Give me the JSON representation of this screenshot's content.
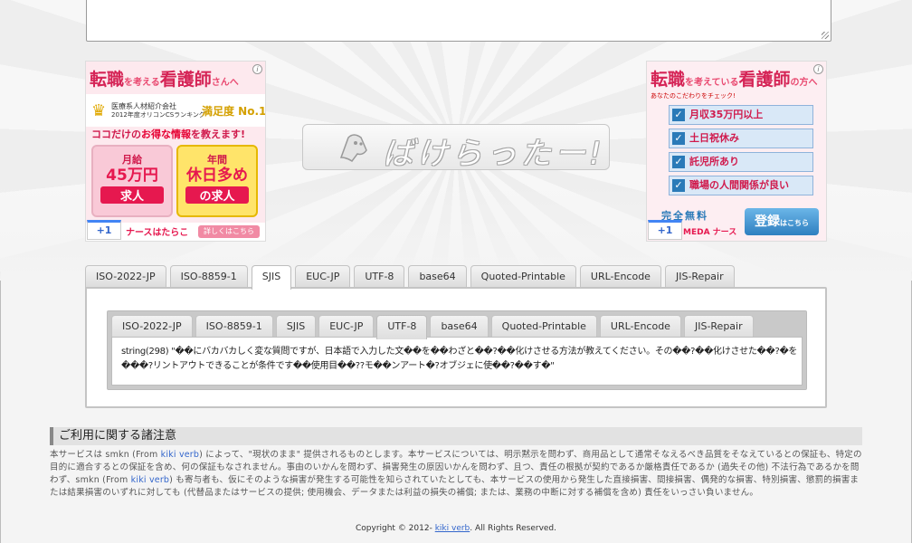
{
  "ads": {
    "left": {
      "title_a": "転職",
      "title_b": "を考える",
      "title_c": "看護師",
      "title_d": "さんへ",
      "sub1": "医療系人材紹介会社",
      "sub2": "2012年度オリコンCSランキング",
      "no1": "満足度 No.1",
      "line_a": "ココだけの",
      "line_b": "お得な情報",
      "line_c": "を教えます!",
      "card1_top": "月給",
      "card1_mid": "45万円",
      "card1_bot": "求人",
      "card2_top": "年間",
      "card2_mid": "休日多め",
      "card2_bot": "の求人",
      "brand": "ナースはたらこ",
      "cta": "詳しくはこちら",
      "plus1": "+1",
      "info": "i"
    },
    "right": {
      "title_a": "転職",
      "title_b": "を考えている",
      "title_c": "看護師",
      "title_d": "の方へ",
      "note": "あなたのこだわりをチェック!",
      "checks": [
        "月収35万円以上",
        "土日祝休み",
        "託児所あり",
        "職場の人間関係が良い"
      ],
      "free": "完全無料",
      "register": "登録",
      "register_small": "はこちら",
      "nurse": "MEDA ナース",
      "plus1": "+1",
      "info": "i"
    }
  },
  "logo": {
    "text": "ばけらったー!"
  },
  "outer_tabs": [
    "ISO-2022-JP",
    "ISO-8859-1",
    "SJIS",
    "EUC-JP",
    "UTF-8",
    "base64",
    "Quoted-Printable",
    "URL-Encode",
    "JIS-Repair"
  ],
  "outer_active": 2,
  "inner_tabs": [
    "ISO-2022-JP",
    "ISO-8859-1",
    "SJIS",
    "EUC-JP",
    "UTF-8",
    "base64",
    "Quoted-Printable",
    "URL-Encode",
    "JIS-Repair"
  ],
  "inner_active": 4,
  "result": {
    "line1": "string(298) \"��にバカバカしく変な質問ですが、日本語で入力した文��を��わざと��?��化けさせる方法が教えてください。その��?��化けさせた��?�を",
    "line2": "���?リントアウトできることが条件です��使用目��??モ��ンアート�?オブジェに使��?��す�\""
  },
  "notice": {
    "title": "ご利用に関する諸注意",
    "p1": "本サービスは smkn (From ",
    "link1": "kiki verb",
    "p2": ") によって、\"現状のまま\" 提供されるものとします。本サービスについては、明示黙示を問わず、商用品として通常そなえるべき品質をそなえているとの保証も、特定の目的に適合するとの保証を含め、何の保証もなされません。事由のいかんを問わず、損害発生の原因いかんを問わず、且つ、責任の根拠が契約であるか厳格責任であるか (過失その他) 不法行為であるかを問わず、smkn (From ",
    "link2": "kiki verb",
    "p3": ") も寄与者も、仮にそのような損害が発生する可能性を知らされていたとしても、本サービスの使用から発生した直接損害、間接損害、偶発的な損害、特別損害、懲罰的損害または結果損害のいずれに対しても (代替品またはサービスの提供; 使用機会、データまたは利益の損失の補償; または、業務の中断に対する補償を含め) 責任をいっさい負いません。"
  },
  "footer": {
    "pre": "Copyright © 2012- ",
    "link": "kiki verb",
    "post": ". All Rights Reserved."
  }
}
